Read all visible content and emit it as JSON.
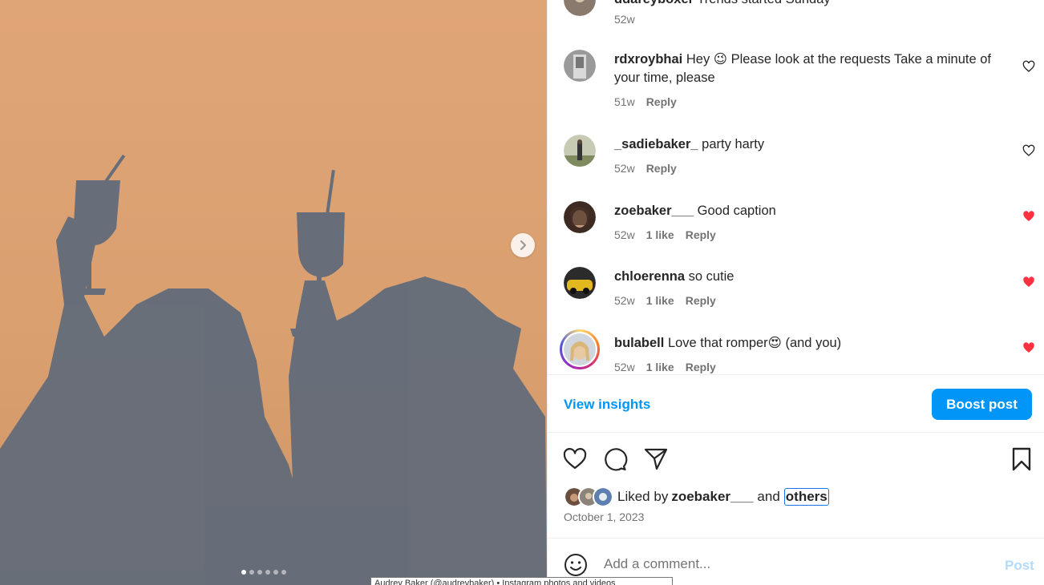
{
  "media": {
    "next_icon": "chevron-right-icon",
    "dots_total": 6,
    "dots_active_index": 0
  },
  "comments": [
    {
      "username": "ddareyboxer",
      "text": "Trends started Sunday",
      "time": "52w",
      "likes": "",
      "reply": "",
      "liked": false,
      "has_heart": false,
      "avatar_color": "#8a7a6e"
    },
    {
      "username": "rdxroybhai",
      "text": "Hey 😉 Please look at the requests Take a minute of your time, please",
      "time": "51w",
      "likes": "",
      "reply": "Reply",
      "liked": false,
      "has_heart": true,
      "avatar_color": "#9a9a9a"
    },
    {
      "username": "_sadiebaker_",
      "text": "party harty",
      "time": "52w",
      "likes": "",
      "reply": "Reply",
      "liked": false,
      "has_heart": true,
      "avatar_color": "#b8b8a0"
    },
    {
      "username": "zoebaker___",
      "text": "Good caption",
      "time": "52w",
      "likes": "1 like",
      "reply": "Reply",
      "liked": true,
      "has_heart": true,
      "avatar_color": "#6b4e3d"
    },
    {
      "username": "chloerenna",
      "text": "so cutie",
      "time": "52w",
      "likes": "1 like",
      "reply": "Reply",
      "liked": true,
      "has_heart": true,
      "avatar_color": "#c9a227"
    },
    {
      "username": "bulabell",
      "text": "Love that romper😍 (and you)",
      "time": "52w",
      "likes": "1 like",
      "reply": "Reply",
      "liked": true,
      "has_heart": true,
      "avatar_color": "#d8c39a"
    }
  ],
  "actions": {
    "view_insights": "View insights",
    "boost_post": "Boost post"
  },
  "icons": {
    "like": "heart-outline-icon",
    "comment": "comment-bubble-icon",
    "share": "send-paper-plane-icon",
    "save": "bookmark-icon"
  },
  "likes": {
    "prefix": "Liked by",
    "user": "zoebaker___",
    "and": "and",
    "others": "others"
  },
  "date": "October 1, 2023",
  "add_comment": {
    "placeholder": "Add a comment...",
    "post": "Post"
  },
  "tooltip": "Audrey Baker (@audreybaker) • Instagram photos and videos",
  "colors": {
    "accent": "#0095f6",
    "liked_heart": "#ff3040",
    "muted_text": "#737373"
  }
}
